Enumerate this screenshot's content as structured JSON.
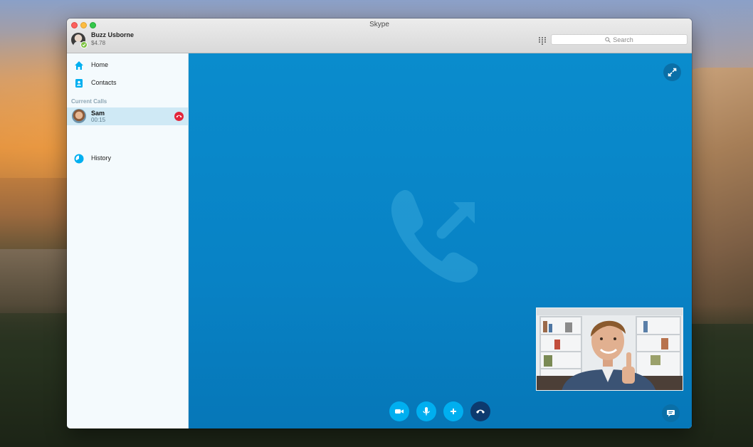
{
  "window": {
    "title": "Skype"
  },
  "profile": {
    "name": "Buzz Usborne",
    "credit": "$4.78",
    "status_color": "#7dc242"
  },
  "search": {
    "placeholder": "Search"
  },
  "sidebar": {
    "items": [
      {
        "label": "Home",
        "icon": "home-icon"
      },
      {
        "label": "Contacts",
        "icon": "contacts-icon"
      },
      {
        "label": "History",
        "icon": "history-icon"
      }
    ],
    "current_calls_label": "Current Calls",
    "calls": [
      {
        "name": "Sam",
        "duration": "00:15"
      }
    ]
  },
  "call_controls": [
    "video-icon",
    "microphone-icon",
    "add-icon",
    "end-call-icon"
  ],
  "colors": {
    "accent": "#00aff0",
    "stage": "#0a8ccd",
    "end_call": "#0d3a6e",
    "hangup": "#e3263b"
  }
}
